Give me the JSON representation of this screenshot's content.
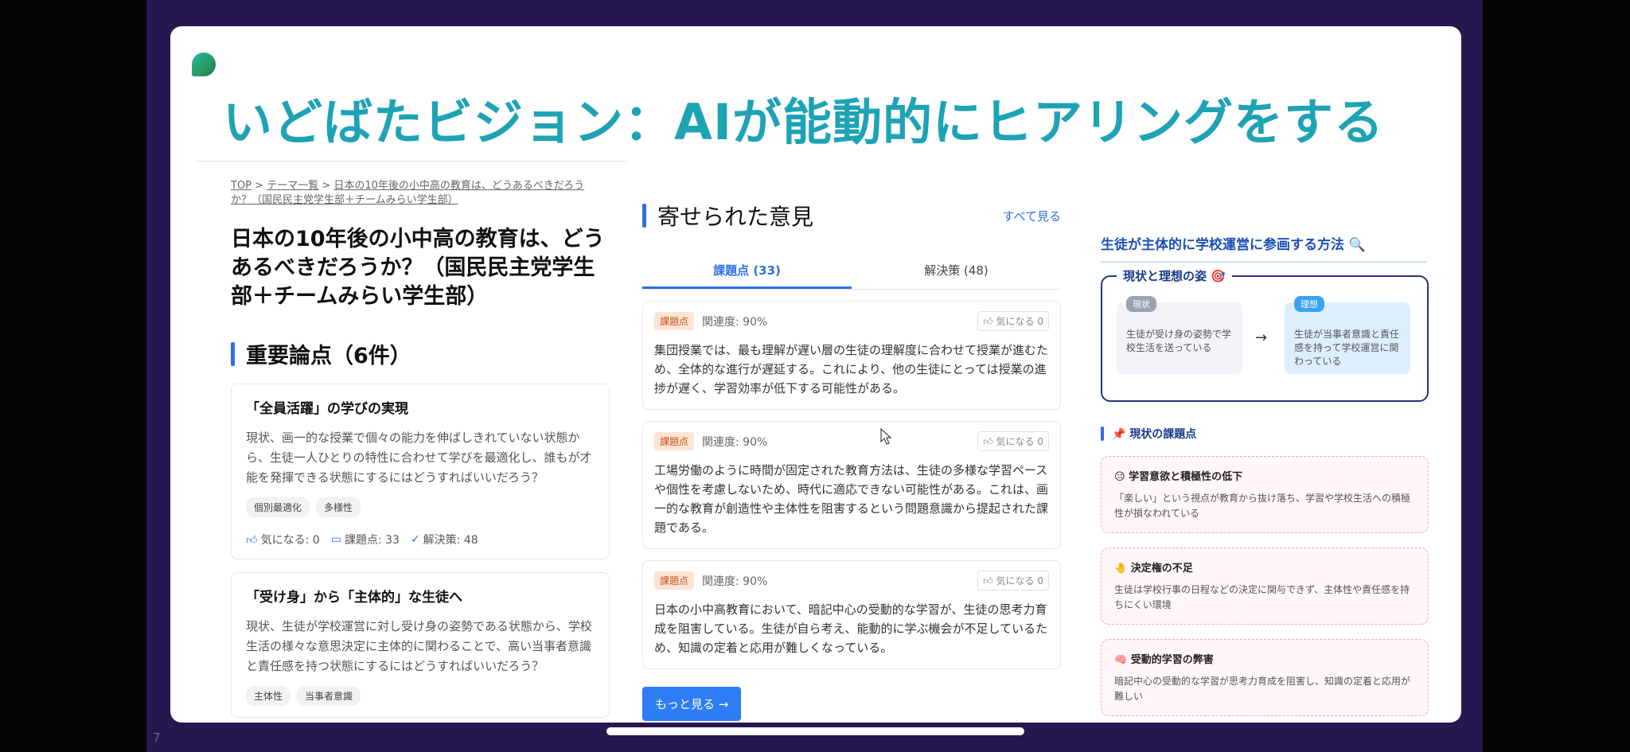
{
  "slide": {
    "title": "いどばたビジョン：AIが能動的にヒアリングをする",
    "page_number": "7"
  },
  "left": {
    "breadcrumb": {
      "top": "TOP",
      "sep1": " > ",
      "theme": "テーマ一覧",
      "sep2": " > ",
      "current": "日本の10年後の小中高の教育は、どうあるべきだろうか？（国民民主党学生部＋チームみらい学生部）"
    },
    "page_title": "日本の10年後の小中高の教育は、どうあるべきだろうか？（国民民主党学生部＋チームみらい学生部）",
    "section_title": "重要論点（6件）",
    "cards": [
      {
        "title": "「全員活躍」の学びの実現",
        "body": "現状、画一的な授業で個々の能力を伸ばしきれていない状態から、生徒一人ひとりの特性に合わせて学びを最適化し、誰もが才能を発揮できる状態にするにはどうすればいいだろう？",
        "tags": [
          "個別最適化",
          "多様性"
        ],
        "stats": {
          "like": "気になる: 0",
          "issues": "課題点: 33",
          "solutions": "解決策: 48"
        }
      },
      {
        "title": "「受け身」から「主体的」な生徒へ",
        "body": "現状、生徒が学校運営に対し受け身の姿勢である状態から、学校生活の様々な意思決定に主体的に関わることで、高い当事者意識と責任感を持つ状態にするにはどうすればいいだろう？",
        "tags": [
          "主体性",
          "当事者意識"
        ]
      }
    ]
  },
  "middle": {
    "title": "寄せられた意見",
    "see_all": "すべて見る",
    "tabs": [
      "課題点 (33)",
      "解決策 (48)"
    ],
    "opinions": [
      {
        "badge": "課題点",
        "relevance": "関連度: 90%",
        "like": "気になる 0",
        "text": "集団授業では、最も理解が遅い層の生徒の理解度に合わせて授業が進むため、全体的な進行が遅延する。これにより、他の生徒にとっては授業の進捗が遅く、学習効率が低下する可能性がある。"
      },
      {
        "badge": "課題点",
        "relevance": "関連度: 90%",
        "like": "気になる 0",
        "text": "工場労働のように時間が固定された教育方法は、生徒の多様な学習ペースや個性を考慮しないため、時代に適応できない可能性がある。これは、画一的な教育が創造性や主体性を阻害するという問題意識から提起された課題である。"
      },
      {
        "badge": "課題点",
        "relevance": "関連度: 90%",
        "like": "気になる 0",
        "text": "日本の小中高教育において、暗記中心の受動的な学習が、生徒の思考力育成を阻害している。生徒が自ら考え、能動的に学ぶ機会が不足しているため、知識の定着と応用が難しくなっている。"
      }
    ],
    "more_button": "もっと見る →"
  },
  "right": {
    "title": "生徒が主体的に学校運営に参画する方法 🔍",
    "vision_label": "現状と理想の姿 🎯",
    "current_tag": "現状",
    "current_text": "生徒が受け身の姿勢で学校生活を送っている",
    "arrow": "→",
    "ideal_tag": "理想",
    "ideal_text": "生徒が当事者意識と責任感を持って学校運営に関わっている",
    "problems_title": "📌 現状の課題点",
    "problems": [
      {
        "title": "😐 学習意欲と積極性の低下",
        "text": "「楽しい」という視点が教育から抜け落ち、学習や学校生活への積極性が損なわれている"
      },
      {
        "title": "🤚 決定権の不足",
        "text": "生徒は学校行事の日程などの決定に関与できず、主体性や責任感を持ちにくい環境"
      },
      {
        "title": "🧠 受動的学習の弊害",
        "text": "暗記中心の受動的な学習が思考力育成を阻害し、知識の定着と応用が難しい"
      }
    ]
  },
  "colors": {
    "title": "#1ea3b5",
    "accent": "#2f6fe4",
    "stage": "#27174f",
    "badge_bg": "#fde3d4",
    "problem_border": "#f1a9b6"
  }
}
